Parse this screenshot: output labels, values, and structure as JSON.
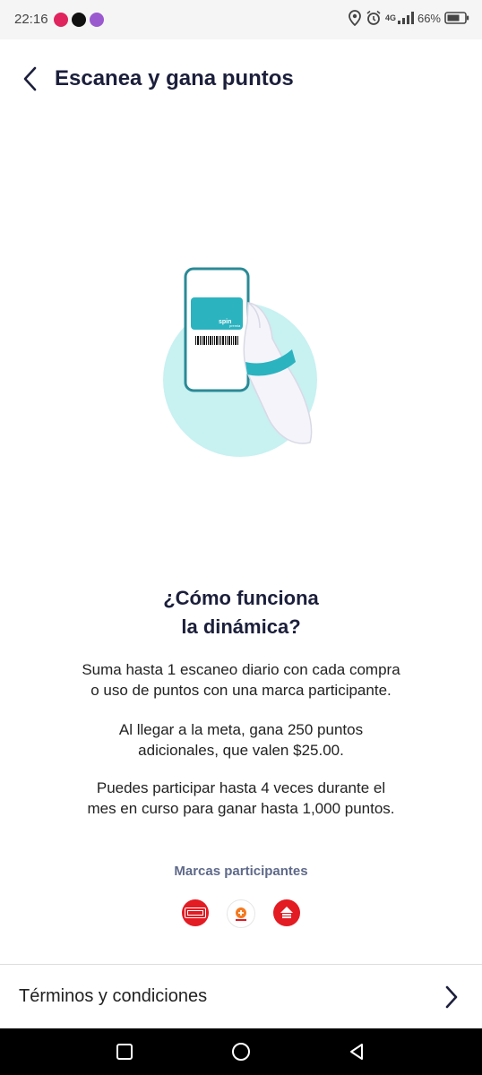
{
  "status_bar": {
    "time": "22:16",
    "network": "4G",
    "battery": "66%",
    "app_icons": [
      "activity-app-icon",
      "tiktok-icon",
      "spiral-app-icon"
    ]
  },
  "header": {
    "title": "Escanea y gana puntos",
    "back_icon": "chevron-left-icon"
  },
  "illustration": {
    "card_brand": "spin",
    "card_sub": "premia"
  },
  "content": {
    "heading_line1": "¿Cómo funciona",
    "heading_line2": "la dinámica?",
    "p1_line1": "Suma hasta 1 escaneo diario con cada compra",
    "p1_line2": "o uso de puntos con una marca participante.",
    "p2_line1": "Al llegar a la meta, gana 250 puntos",
    "p2_line2": "adicionales, que valen $25.00.",
    "p3_line1": "Puedes participar hasta 4 veces durante el",
    "p3_line2": "mes en curso para ganar hasta 1,000 puntos."
  },
  "brands": {
    "title": "Marcas participantes",
    "items": [
      {
        "name": "OXXO",
        "color": "#e31b23"
      },
      {
        "name": "Bilarizal",
        "color": "#f47a20"
      },
      {
        "name": "SOMA YOYA",
        "color": "#e31b23"
      }
    ]
  },
  "terms": {
    "label": "Términos y condiciones",
    "icon": "chevron-right-icon"
  },
  "colors": {
    "title": "#1b1f3b",
    "accent_teal": "#2bb3c0",
    "circle_bg": "#c8f1f1"
  }
}
